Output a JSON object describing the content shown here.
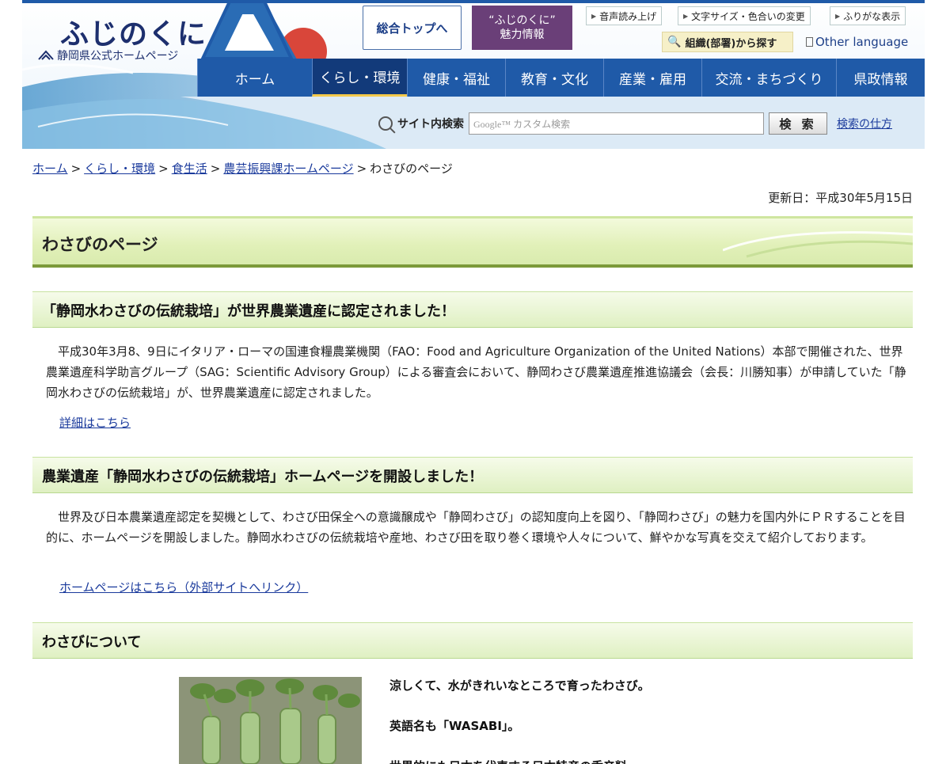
{
  "header": {
    "logo_main": "ふじのくに",
    "logo_sub": "静岡県公式ホームページ",
    "top_button": "総合トップへ",
    "miryoku_line1": "“ふじのくに”",
    "miryoku_line2": "魅力情報",
    "util": [
      "音声読み上げ",
      "文字サイズ・色合いの変更",
      "ふりがな表示"
    ],
    "org_search": "組織(部署)から探す",
    "other_language": "Other language",
    "nav": [
      "ホーム",
      "くらし・環境",
      "健康・福祉",
      "教育・文化",
      "産業・雇用",
      "交流・まちづくり",
      "県政情報"
    ],
    "nav_active": "くらし・環境",
    "search_label": "サイト内検索",
    "search_placeholder": "Google™ カスタム検索",
    "search_button": "検 索",
    "search_help": "検索の仕方"
  },
  "breadcrumb": {
    "items": [
      "ホーム",
      "くらし・環境",
      "食生活",
      "農芸振興課ホームページ"
    ],
    "current": "わさびのページ"
  },
  "updated": "更新日：平成30年5月15日",
  "page_title": "わさびのページ",
  "sections": [
    {
      "heading": "「静岡水わさびの伝統栽培」が世界農業遺産に認定されました！",
      "body": "平成30年3月8、9日にイタリア・ローマの国連食糧農業機関（FAO：Food and Agriculture Organization of the United Nations）本部で開催された、世界農業遺産科学助言グループ（SAG：Scientific Advisory Group）による審査会において、静岡わさび農業遺産推進協議会（会長：川勝知事）が申請していた「静岡水わさびの伝統栽培」が、世界農業遺産に認定されました。",
      "link": "詳細はこちら"
    },
    {
      "heading": "農業遺産「静岡水わさびの伝統栽培」ホームページを開設しました！",
      "body": "世界及び日本農業遺産認定を契機として、わさび田保全への意識醸成や「静岡わさび」の認知度向上を図り、「静岡わさび」の魅力を国内外にＰＲすることを目的に、ホームページを開設しました。静岡水わさびの伝統栽培や産地、わさび田を取り巻く環境や人々について、鮮やかな写真を交えて紹介しております。",
      "link": "ホームページはこちら（外部サイトへリンク）"
    },
    {
      "heading": "わさびについて",
      "lines": [
        "涼しくて、水がきれいなところで育ったわさび。",
        "英語名も「WASABI」。",
        "世界的にも日本を代表する日本特産の香辛料。"
      ]
    }
  ],
  "colors": {
    "nav_blue": "#1f5aa8",
    "nav_active": "#123a7a",
    "miryoku_purple": "#6a3f78",
    "section_green": "#dff0c2",
    "title_border": "#7c9a3a",
    "link_blue": "#1a3a9c"
  }
}
